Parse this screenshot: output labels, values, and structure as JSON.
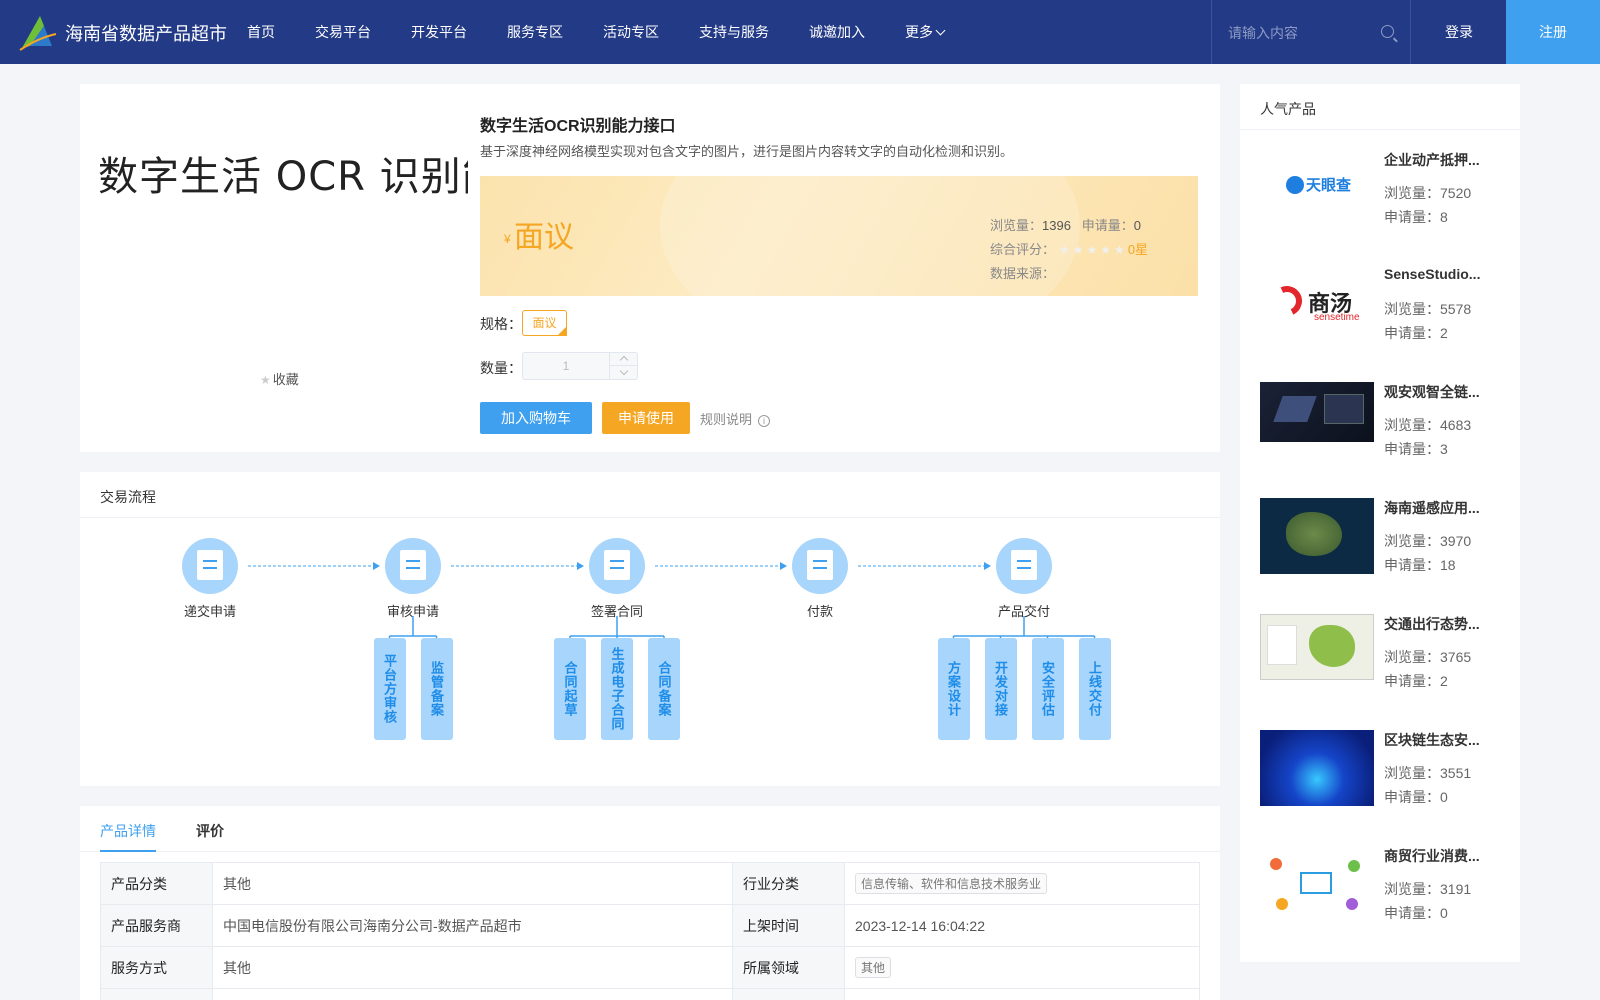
{
  "header": {
    "site_title": "海南省数据产品超市",
    "nav": [
      "首页",
      "交易平台",
      "开发平台",
      "服务专区",
      "活动专区",
      "支持与服务",
      "诚邀加入",
      "更多"
    ],
    "search_placeholder": "请输入内容",
    "login_label": "登录",
    "register_label": "注册"
  },
  "product": {
    "image_text": "数字生活 OCR 识别能力",
    "collect_label": "收藏",
    "title": "数字生活OCR识别能力接口",
    "description": "基于深度神经网络模型实现对包含文字的图片，进行是图片内容转文字的自动化检测和识别。",
    "price_currency": "¥",
    "price_label": "面议",
    "views_label": "浏览量：",
    "views_value": "1396",
    "applications_label": "申请量：",
    "applications_value": "0",
    "rating_label": "综合评分：",
    "rating_stars": 0,
    "rating_text": "0星",
    "source_label": "数据来源：",
    "spec_label": "规格：",
    "spec_option": "面议",
    "quantity_label": "数量：",
    "quantity_value": "1",
    "add_to_cart_label": "加入购物车",
    "apply_label": "申请使用",
    "rules_label": "规则说明"
  },
  "process": {
    "title": "交易流程",
    "steps": [
      {
        "label": "递交申请",
        "icon": "form-icon",
        "subs": []
      },
      {
        "label": "审核申请",
        "icon": "document-review-icon",
        "subs": [
          "平台方审核",
          "监管备案"
        ]
      },
      {
        "label": "签署合同",
        "icon": "contract-sign-icon",
        "subs": [
          "合同起草",
          "生成电子合同",
          "合同备案"
        ]
      },
      {
        "label": "付款",
        "icon": "payment-icon",
        "subs": []
      },
      {
        "label": "产品交付",
        "icon": "delivery-list-icon",
        "subs": [
          "方案设计",
          "开发对接",
          "安全评估",
          "上线交付"
        ]
      }
    ]
  },
  "details": {
    "tabs": [
      "产品详情",
      "评价"
    ],
    "rows": [
      {
        "k1": "产品分类",
        "v1": "其他",
        "k2": "行业分类",
        "v2": "信息传输、软件和信息技术服务业",
        "v2_tag": true
      },
      {
        "k1": "产品服务商",
        "v1": "中国电信股份有限公司海南分公司-数据产品超市",
        "k2": "上架时间",
        "v2": "2023-12-14 16:04:22",
        "v2_tag": false
      },
      {
        "k1": "服务方式",
        "v1": "其他",
        "k2": "所属领域",
        "v2": "其他",
        "v2_tag": true
      }
    ]
  },
  "sidebar": {
    "title": "人气产品",
    "views_prefix": "浏览量：",
    "apps_prefix": "申请量：",
    "items": [
      {
        "name": "企业动产抵押...",
        "views": "7520",
        "apps": "8",
        "thumb": "tianyancha-logo"
      },
      {
        "name": "SenseStudio...",
        "views": "5578",
        "apps": "2",
        "thumb": "sensetime-logo"
      },
      {
        "name": "观安观智全链...",
        "views": "4683",
        "apps": "3",
        "thumb": "dark-device-image"
      },
      {
        "name": "海南遥感应用...",
        "views": "3970",
        "apps": "18",
        "thumb": "satellite-map-image"
      },
      {
        "name": "交通出行态势...",
        "views": "3765",
        "apps": "2",
        "thumb": "traffic-map-image"
      },
      {
        "name": "区块链生态安...",
        "views": "3551",
        "apps": "0",
        "thumb": "blockchain-image"
      },
      {
        "name": "商贸行业消费...",
        "views": "3191",
        "apps": "0",
        "thumb": "network-icons-image"
      }
    ]
  },
  "colors": {
    "header_bg": "#233a86",
    "primary": "#3fa0ef",
    "accent": "#f5a623",
    "flow_icon": "#a7d5fb"
  }
}
